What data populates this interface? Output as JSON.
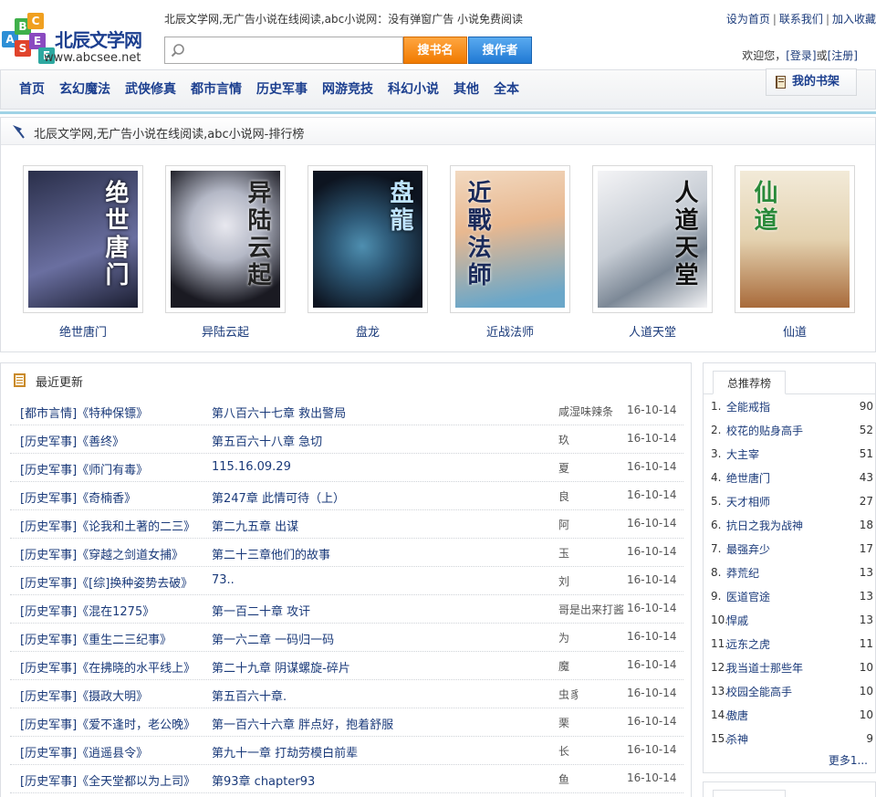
{
  "header": {
    "logo_name": "北辰文学网",
    "logo_url": "www.abcsee.net",
    "logo_letters": [
      "A",
      "B",
      "C",
      "S",
      "E",
      "E"
    ],
    "tagline": "北辰文学网,无广告小说在线阅读,abc小说网：没有弹窗广告 小说免费阅读",
    "links": [
      "设为首页",
      "联系我们",
      "加入收藏"
    ],
    "search": {
      "value": "",
      "placeholder": ""
    },
    "btn_search_name": "搜书名",
    "btn_search_author": "搜作者",
    "welcome_prefix": "欢迎您，",
    "login": "[登录]",
    "or": "或",
    "register": "[注册]"
  },
  "nav": {
    "items": [
      "首页",
      "玄幻魔法",
      "武侠修真",
      "都市言情",
      "历史军事",
      "网游竞技",
      "科幻小说",
      "其他",
      "全本"
    ],
    "bookshelf": "我的书架"
  },
  "ranking": {
    "title": "北辰文学网,无广告小说在线阅读,abc小说网-排行榜",
    "books": [
      {
        "name": "绝世唐门",
        "cover_text": "绝世唐门",
        "colors": [
          "#2a2f4a",
          "#6a6fa0"
        ]
      },
      {
        "name": "异陆云起",
        "cover_text": "异陆云起",
        "colors": [
          "#e8e8ef",
          "#8d93a6"
        ]
      },
      {
        "name": "盘龙",
        "cover_text": "盘龍",
        "colors": [
          "#0d1420",
          "#2e5a78"
        ]
      },
      {
        "name": "近战法师",
        "cover_text": "近戰法師",
        "colors": [
          "#f2d9c0",
          "#6aa7c9"
        ]
      },
      {
        "name": "人道天堂",
        "cover_text": "人道天堂",
        "colors": [
          "#f4f4f6",
          "#7c8896"
        ]
      },
      {
        "name": "仙道",
        "cover_text": "仙道",
        "colors": [
          "#f2ead8",
          "#a86a3a"
        ]
      }
    ]
  },
  "recent": {
    "title": "最近更新",
    "rows": [
      {
        "book": "[都市言情]《特种保镖》",
        "chapter": "第八百六十七章 救出警局",
        "author": "咸湿味辣条",
        "date": "16-10-14"
      },
      {
        "book": "[历史军事]《善终》",
        "chapter": "第五百六十八章 急切",
        "author": "玖",
        "date": "16-10-14"
      },
      {
        "book": "[历史军事]《师门有毒》",
        "chapter": "115.16.09.29",
        "author": "夏",
        "date": "16-10-14"
      },
      {
        "book": "[历史军事]《奇楠香》",
        "chapter": "第247章 此情可待（上）",
        "author": "良",
        "date": "16-10-14"
      },
      {
        "book": "[历史军事]《论我和土著的二三》",
        "chapter": "第二九五章 出谋",
        "author": "阿",
        "date": "16-10-14"
      },
      {
        "book": "[历史军事]《穿越之剑道女捕》",
        "chapter": "第二十三章他们的故事",
        "author": "玉",
        "date": "16-10-14"
      },
      {
        "book": "[历史军事]《[综]换种姿势去破》",
        "chapter": "73..",
        "author": "刘",
        "date": "16-10-14"
      },
      {
        "book": "[历史军事]《混在1275》",
        "chapter": "第一百二十章 攻讦",
        "author": "哥是出来打酱",
        "date": "16-10-14"
      },
      {
        "book": "[历史军事]《重生二三纪事》",
        "chapter": "第一六二章 一码归一码",
        "author": "为",
        "date": "16-10-14"
      },
      {
        "book": "[历史军事]《在拂晓的水平线上》",
        "chapter": "第二十九章 阴谋螺旋-碎片",
        "author": "魔",
        "date": "16-10-14"
      },
      {
        "book": "[历史军事]《摄政大明》",
        "chapter": "第五百六十章.",
        "author": "虫豸",
        "date": "16-10-14"
      },
      {
        "book": "[历史军事]《爱不逢时，老公晚》",
        "chapter": "第一百六十六章 胖点好，抱着舒服",
        "author": "栗",
        "date": "16-10-14"
      },
      {
        "book": "[历史军事]《逍遥县令》",
        "chapter": "第九十一章 打劫劳模白前辈",
        "author": "长",
        "date": "16-10-14"
      },
      {
        "book": "[历史军事]《全天堂都以为上司》",
        "chapter": "第93章 chapter93",
        "author": "鱼",
        "date": "16-10-14"
      }
    ]
  },
  "side": {
    "tab": "总推荐榜",
    "items": [
      {
        "num": "1.",
        "name": "全能戒指",
        "count": "90"
      },
      {
        "num": "2.",
        "name": "校花的贴身高手",
        "count": "52"
      },
      {
        "num": "3.",
        "name": "大主宰",
        "count": "51"
      },
      {
        "num": "4.",
        "name": "绝世唐门",
        "count": "43"
      },
      {
        "num": "5.",
        "name": "天才相师",
        "count": "27"
      },
      {
        "num": "6.",
        "name": "抗日之我为战神",
        "count": "18"
      },
      {
        "num": "7.",
        "name": "最强弃少",
        "count": "17"
      },
      {
        "num": "8.",
        "name": "莽荒纪",
        "count": "13"
      },
      {
        "num": "9.",
        "name": "医道官途",
        "count": "13"
      },
      {
        "num": "10.",
        "name": "悍戚",
        "count": "13"
      },
      {
        "num": "11.",
        "name": "远东之虎",
        "count": "11"
      },
      {
        "num": "12.",
        "name": "我当道士那些年",
        "count": "10"
      },
      {
        "num": "13.",
        "name": "校园全能高手",
        "count": "10"
      },
      {
        "num": "14.",
        "name": "傲唐",
        "count": "10"
      },
      {
        "num": "15.",
        "name": "杀神",
        "count": "9"
      }
    ],
    "more": "更多1..."
  }
}
